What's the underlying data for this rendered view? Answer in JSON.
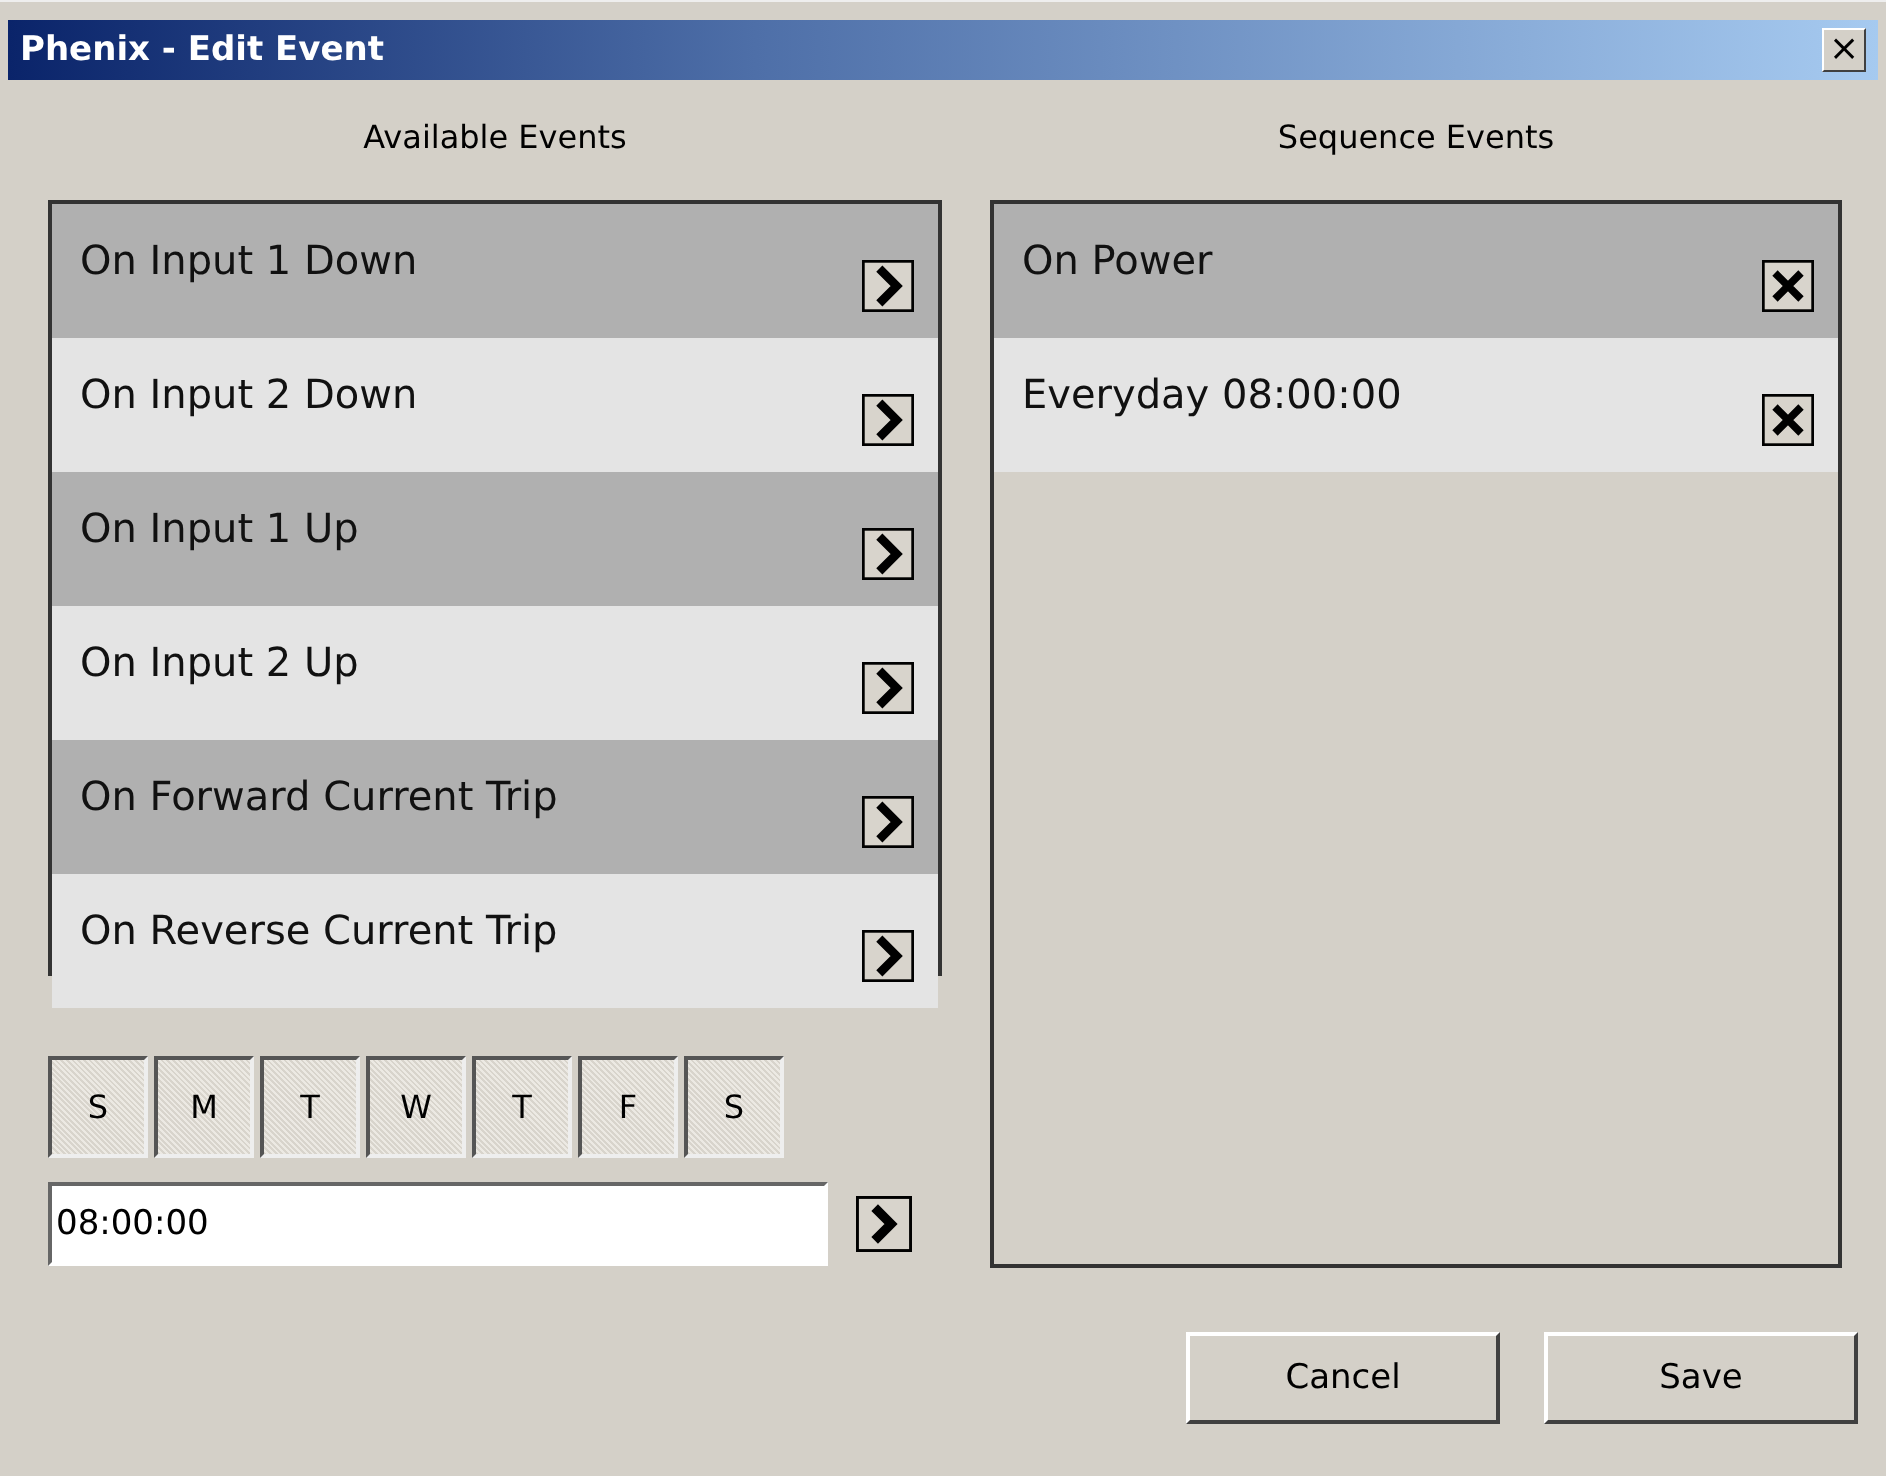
{
  "window": {
    "title": "Phenix - Edit Event",
    "close": "×"
  },
  "available": {
    "heading": "Available Events",
    "items": [
      {
        "label": "On Input 1 Down"
      },
      {
        "label": "On Input 2 Down"
      },
      {
        "label": "On Input 1 Up"
      },
      {
        "label": "On Input 2 Up"
      },
      {
        "label": "On Forward Current Trip"
      },
      {
        "label": "On Reverse Current Trip"
      }
    ]
  },
  "days": [
    {
      "label": "S",
      "selected": true
    },
    {
      "label": "M",
      "selected": true
    },
    {
      "label": "T",
      "selected": true
    },
    {
      "label": "W",
      "selected": true
    },
    {
      "label": "T",
      "selected": true
    },
    {
      "label": "F",
      "selected": true
    },
    {
      "label": "S",
      "selected": true
    }
  ],
  "time": {
    "value": "08:00:00"
  },
  "sequence": {
    "heading": "Sequence Events",
    "items": [
      {
        "label": "On Power"
      },
      {
        "label": "Everyday 08:00:00"
      }
    ]
  },
  "buttons": [
    "Cancel",
    "Save"
  ]
}
